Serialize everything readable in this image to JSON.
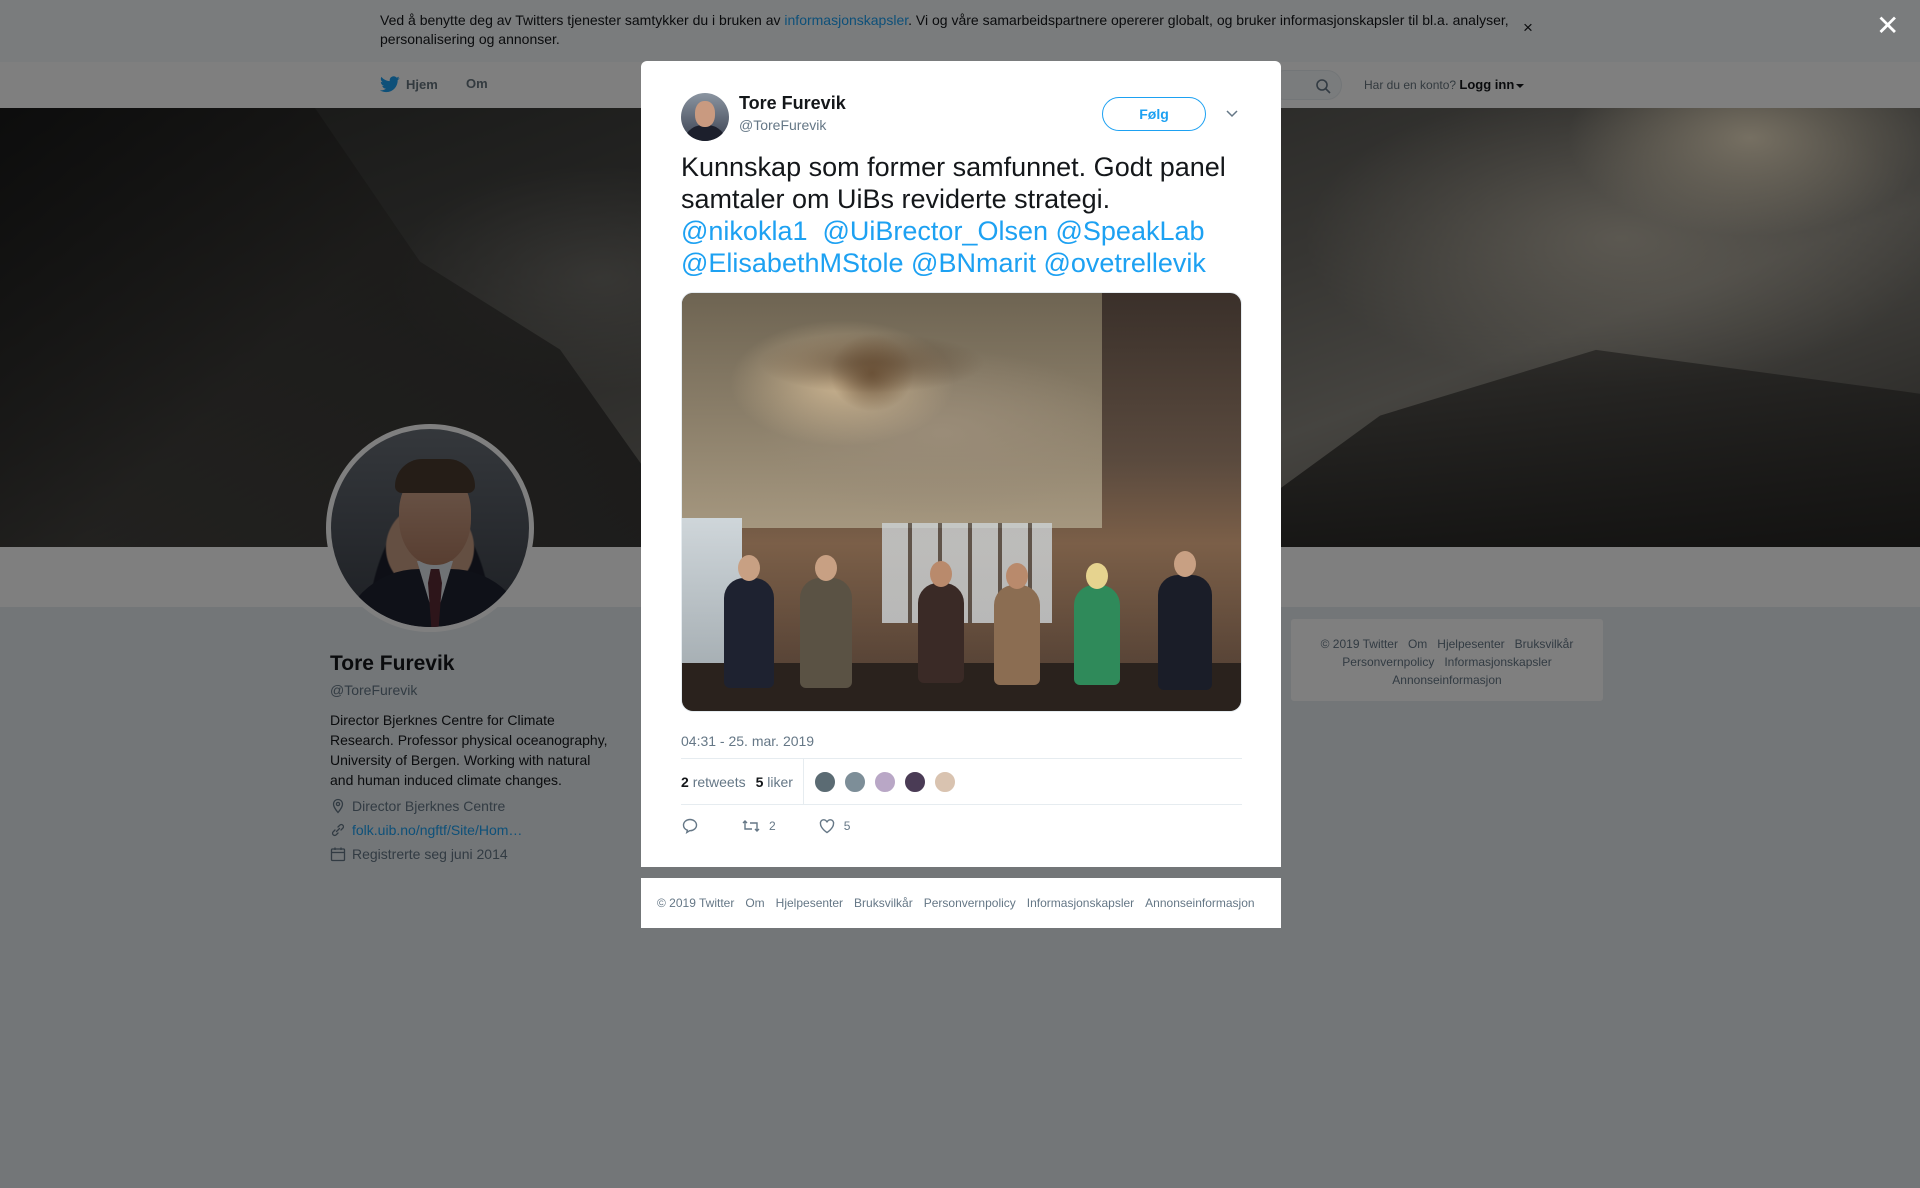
{
  "cookie_banner": {
    "text_before": "Ved å benytte deg av Twitters tjenester samtykker du i bruken av ",
    "link": "informasjonskapsler",
    "text_after": ". Vi og våre samarbeidspartnere opererer globalt, og bruker informasjonskapsler til bl.a. analyser, personalisering og annonser.",
    "close": "×"
  },
  "nav": {
    "home": "Hjem",
    "about": "Om",
    "account_prompt": "Har du en konto?",
    "login": "Logg inn"
  },
  "profile": {
    "name": "Tore Furevik",
    "handle": "@ToreFurevik",
    "bio": "Director Bjerknes Centre for Climate Research. Professor physical oceanography, University of Bergen. Working with natural and human induced climate changes.",
    "location": "Director Bjerknes Centre",
    "url": "folk.uib.no/ngftf/Site/Hom…",
    "joined": "Registrerte seg juni 2014"
  },
  "sidebar_footer": {
    "items": [
      "© 2019 Twitter",
      "Om",
      "Hjelpesenter",
      "Bruksvilkår",
      "Personvernpolicy",
      "Informasjonskapsler",
      "Annonseinformasjon"
    ]
  },
  "overlay": {
    "close": "✕"
  },
  "tweet": {
    "author_name": "Tore Furevik",
    "author_handle": "@ToreFurevik",
    "follow_label": "Følg",
    "text": "Kunnskap som former samfunnet. Godt panel samtaler om UiBs reviderte strategi.",
    "mentions": [
      "@nikokla1",
      "@UiBrector_Olsen",
      "@SpeakLab",
      "@ElisabethMStole",
      "@BNmarit",
      "@ovetrellevik"
    ],
    "timestamp": "04:31 - 25. mar. 2019",
    "retweets_count": "2",
    "retweets_label": "retweets",
    "likes_count": "5",
    "likes_label": "liker",
    "action_retweets": "2",
    "action_likes": "5",
    "liker_colors": [
      "#5b6b73",
      "#7d8e98",
      "#b9a7c6",
      "#4a3b55",
      "#d9c3b0"
    ]
  },
  "modal_footer": {
    "items": [
      "© 2019 Twitter",
      "Om",
      "Hjelpesenter",
      "Bruksvilkår",
      "Personvernpolicy",
      "Informasjonskapsler",
      "Annonseinformasjon"
    ]
  },
  "colors": {
    "accent": "#1da1f2",
    "text": "#14171a",
    "secondary": "#657786"
  }
}
